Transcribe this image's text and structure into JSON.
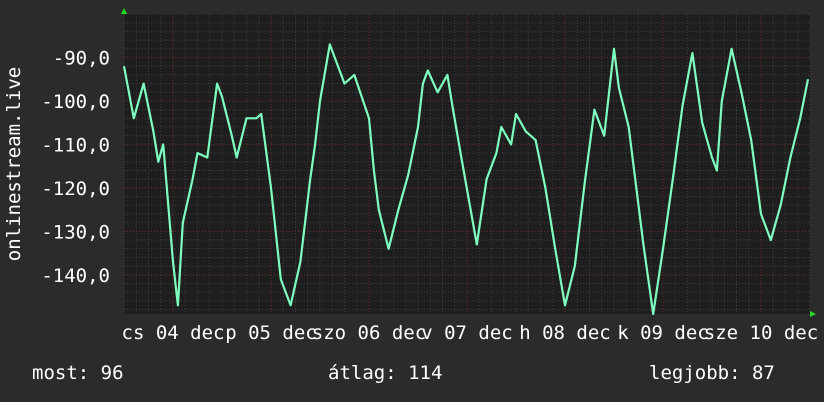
{
  "colors": {
    "background": "#2b2b2b",
    "plot_background": "#1e1e1e",
    "grid_minor": "#3f3f3f",
    "grid_major": "#6b2a2a",
    "line": "#7fffbf",
    "text": "#ffffff",
    "arrow": "#22dd22"
  },
  "chart_data": {
    "type": "line",
    "ylabel": "onlinestream.live",
    "ylim": [
      -149,
      -80
    ],
    "y_ticks": [
      -90,
      -100,
      -110,
      -120,
      -130,
      -140
    ],
    "y_tick_labels": [
      "-90,0",
      "-100,0",
      "-110,0",
      "-120,0",
      "-130,0",
      "-140,0"
    ],
    "x_tick_labels": [
      "cs 04 dec",
      "p 05 dec",
      "szo 06 dec",
      "v 07 dec",
      "h 08 dec",
      "k 09 dec",
      "sze 10 dec"
    ],
    "x_tick_positions": [
      0.5,
      1.5,
      2.5,
      3.5,
      4.5,
      5.5,
      6.5
    ],
    "xlim": [
      0,
      7
    ],
    "grid": true,
    "series": [
      {
        "x": [
          0.0,
          0.1,
          0.2,
          0.3,
          0.35,
          0.4,
          0.5,
          0.55,
          0.6,
          0.7,
          0.75,
          0.85,
          0.95,
          1.0,
          1.1,
          1.15,
          1.25,
          1.35,
          1.4,
          1.5,
          1.6,
          1.7,
          1.8,
          1.9,
          1.95,
          2.0,
          2.1,
          2.25,
          2.35,
          2.5,
          2.55,
          2.6,
          2.7,
          2.8,
          2.9,
          3.0,
          3.05,
          3.1,
          3.2,
          3.3,
          3.35,
          3.45,
          3.6,
          3.7,
          3.8,
          3.85,
          3.95,
          4.0,
          4.1,
          4.2,
          4.3,
          4.4,
          4.5,
          4.6,
          4.7,
          4.8,
          4.9,
          5.0,
          5.05,
          5.15,
          5.2,
          5.3,
          5.4,
          5.5,
          5.6,
          5.7,
          5.8,
          5.9,
          6.0,
          6.05,
          6.1,
          6.2,
          6.3,
          6.4,
          6.5,
          6.6,
          6.7,
          6.8,
          6.9,
          6.98
        ],
        "y": [
          -92,
          -104,
          -96,
          -107,
          -114,
          -110,
          -137,
          -147,
          -128,
          -118,
          -112,
          -113,
          -96,
          -99,
          -108,
          -113,
          -104,
          -104,
          -103,
          -120,
          -141,
          -147,
          -137,
          -118,
          -110,
          -100,
          -87,
          -96,
          -94,
          -104,
          -116,
          -125,
          -134,
          -125,
          -117,
          -106,
          -96,
          -93,
          -98,
          -94,
          -101,
          -114,
          -133,
          -118,
          -112,
          -106,
          -110,
          -103,
          -107,
          -109,
          -120,
          -134,
          -147,
          -138,
          -119,
          -102,
          -108,
          -88,
          -97,
          -106,
          -115,
          -133,
          -149,
          -134,
          -118,
          -101,
          -89,
          -105,
          -113,
          -116,
          -100,
          -88,
          -98,
          -109,
          -126,
          -132,
          -124,
          -113,
          -104,
          -95
        ]
      }
    ]
  },
  "stats": {
    "current": "most: 96",
    "average": "átlag: 114",
    "best": "legjobb: 87"
  }
}
